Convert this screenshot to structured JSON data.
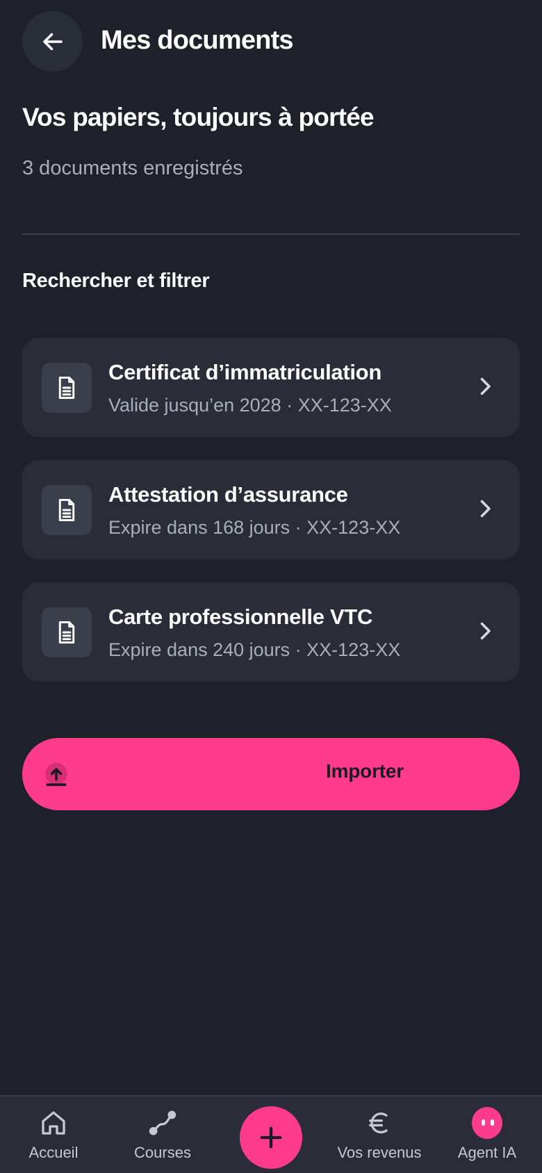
{
  "header": {
    "title": "Mes documents",
    "back_icon": "arrow-left-icon"
  },
  "hero": {
    "title": "Vos papiers, toujours à portée",
    "subtitle": "3 documents enregistrés"
  },
  "filter": {
    "label": "Rechercher et filtrer"
  },
  "documents": [
    {
      "title": "Certificat d’immatriculation",
      "subtitle": "Valide jusqu’en 2028 · XX-123-XX",
      "icon": "document-icon"
    },
    {
      "title": "Attestation d’assurance",
      "subtitle": "Expire dans 168 jours · XX-123-XX",
      "icon": "document-icon"
    },
    {
      "title": "Carte professionnelle VTC",
      "subtitle": "Expire dans 240 jours · XX-123-XX",
      "icon": "document-icon"
    }
  ],
  "import_button": {
    "label": "Importer",
    "icon": "upload-icon"
  },
  "nav": {
    "items": [
      {
        "label": "Accueil",
        "icon": "home-icon"
      },
      {
        "label": "Courses",
        "icon": "route-icon"
      },
      {
        "label": "",
        "icon": "plus-icon"
      },
      {
        "label": "Vos revenus",
        "icon": "euro-icon"
      },
      {
        "label": "Agent IA",
        "icon": "agent-icon"
      }
    ]
  },
  "colors": {
    "background": "#1e212a",
    "card": "#2a2d37",
    "accent": "#ff3b8b",
    "muted_text": "#a9aebb"
  }
}
